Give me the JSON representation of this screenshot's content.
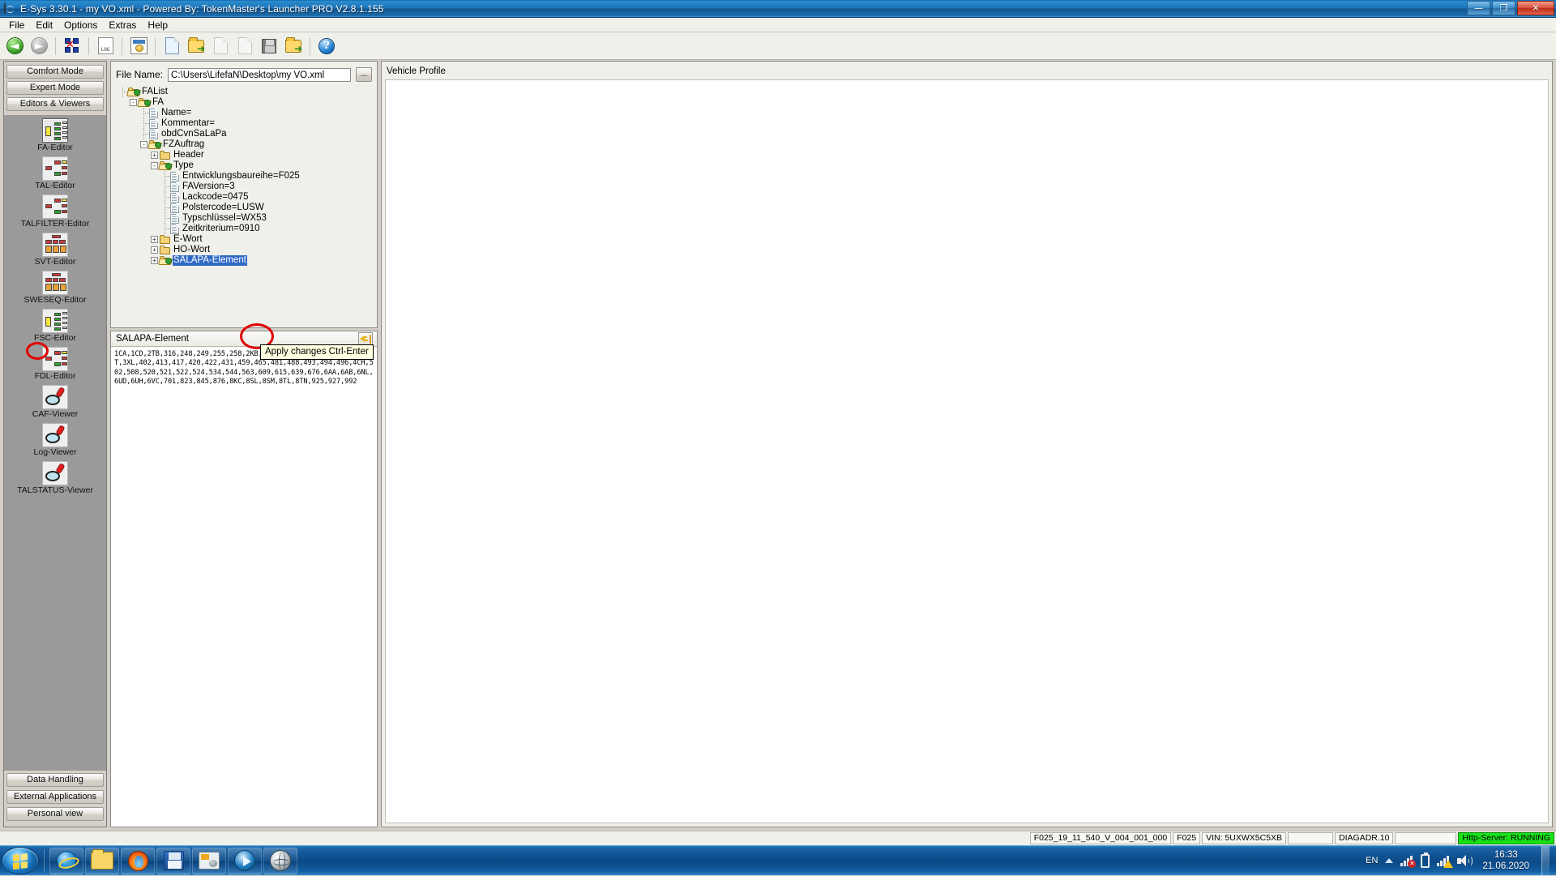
{
  "window": {
    "title": "E-Sys 3.30.1 - my VO.xml   - Powered By: TokenMaster's Launcher PRO V2.8.1.155",
    "minimize": "—",
    "maximize": "❐",
    "close": "✕"
  },
  "menu": {
    "items": [
      "File",
      "Edit",
      "Options",
      "Extras",
      "Help"
    ]
  },
  "toolbar": {
    "items": [
      {
        "name": "back-button",
        "icon": "left-arrow-circle-icon"
      },
      {
        "name": "forward-button",
        "icon": "right-arrow-circle-icon"
      },
      {
        "name": "connection-button",
        "icon": "network-connect-icon"
      },
      {
        "name": "log-button",
        "icon": "log-document-icon"
      },
      {
        "name": "vehicle-window-button",
        "icon": "window-vehicle-icon"
      },
      {
        "name": "new-button",
        "icon": "new-document-icon"
      },
      {
        "name": "open-button",
        "icon": "open-folder-icon"
      },
      {
        "name": "import-button",
        "icon": "import-arrow-icon"
      },
      {
        "name": "export-button",
        "icon": "export-arrow-icon"
      },
      {
        "name": "save-button",
        "icon": "floppy-disk-icon"
      },
      {
        "name": "save-as-button",
        "icon": "folder-save-icon"
      },
      {
        "name": "help-button",
        "icon": "help-question-icon"
      }
    ]
  },
  "sidebar": {
    "modes": [
      "Comfort Mode",
      "Expert Mode",
      "Editors & Viewers"
    ],
    "editors": [
      {
        "label": "FA-Editor",
        "icon": "tree-editor-icon",
        "selected": true
      },
      {
        "label": "TAL-Editor",
        "icon": "tree-editor-icon",
        "selected": false
      },
      {
        "label": "TALFILTER-Editor",
        "icon": "tree-editor-icon",
        "selected": false
      },
      {
        "label": "SVT-Editor",
        "icon": "tree-grid-icon",
        "selected": false
      },
      {
        "label": "SWESEQ-Editor",
        "icon": "tree-grid-icon",
        "selected": false
      },
      {
        "label": "FSC-Editor",
        "icon": "tree-editor-icon",
        "selected": false
      },
      {
        "label": "FDL-Editor",
        "icon": "tree-editor-icon",
        "selected": false
      },
      {
        "label": "CAF-Viewer",
        "icon": "magnifier-icon",
        "selected": false
      },
      {
        "label": "Log-Viewer",
        "icon": "magnifier-icon",
        "selected": false
      },
      {
        "label": "TALSTATUS-Viewer",
        "icon": "magnifier-icon",
        "selected": false
      }
    ],
    "bottom_buttons": [
      "Data Handling",
      "External Applications",
      "Personal view"
    ]
  },
  "fa_editor": {
    "file_label": "File Name:",
    "file_value": "C:\\Users\\LifefaN\\Desktop\\my VO.xml",
    "browse_label": "...",
    "tree": [
      {
        "label": "FAList",
        "depth": 0,
        "type": "folder-green",
        "toggle": "",
        "selected": false
      },
      {
        "label": "FA",
        "depth": 1,
        "type": "folder-green",
        "toggle": "-",
        "selected": false
      },
      {
        "label": "Name=",
        "depth": 2,
        "type": "document",
        "toggle": "",
        "selected": false
      },
      {
        "label": "Kommentar=",
        "depth": 2,
        "type": "document",
        "toggle": "",
        "selected": false
      },
      {
        "label": "obdCvnSaLaPa",
        "depth": 2,
        "type": "document",
        "toggle": "",
        "selected": false
      },
      {
        "label": "FZAuftrag",
        "depth": 2,
        "type": "folder-green",
        "toggle": "-",
        "selected": false
      },
      {
        "label": "Header",
        "depth": 3,
        "type": "folder",
        "toggle": "+",
        "selected": false
      },
      {
        "label": "Type",
        "depth": 3,
        "type": "folder-green",
        "toggle": "-",
        "selected": false
      },
      {
        "label": "Entwicklungsbaureihe=F025",
        "depth": 4,
        "type": "document",
        "toggle": "",
        "selected": false
      },
      {
        "label": "FAVersion=3",
        "depth": 4,
        "type": "document",
        "toggle": "",
        "selected": false
      },
      {
        "label": "Lackcode=0475",
        "depth": 4,
        "type": "document",
        "toggle": "",
        "selected": false
      },
      {
        "label": "Polstercode=LUSW",
        "depth": 4,
        "type": "document",
        "toggle": "",
        "selected": false
      },
      {
        "label": "Typschlüssel=WX53",
        "depth": 4,
        "type": "document",
        "toggle": "",
        "selected": false
      },
      {
        "label": "Zeitkriterium=0910",
        "depth": 4,
        "type": "document",
        "toggle": "",
        "selected": false
      },
      {
        "label": "E-Wort",
        "depth": 3,
        "type": "folder",
        "toggle": "+",
        "selected": false
      },
      {
        "label": "HO-Wort",
        "depth": 3,
        "type": "folder",
        "toggle": "+",
        "selected": false
      },
      {
        "label": "SALAPA-Element",
        "depth": 3,
        "type": "folder-green",
        "toggle": "+",
        "selected": true
      }
    ]
  },
  "salapa": {
    "title": "SALAPA-Element",
    "apply_icon": "apply-arrow-icon",
    "value": "1CA,1CD,2TB,316,248,249,255,258,2KB,2VB,302,316,319,322,3AH,3AT,3XL,402,413,417,420,422,431,459,465,481,488,493,494,496,4CH,502,508,520,521,522,524,534,544,563,609,615,639,676,6AA,6AB,6NL,6UD,6UH,6VC,701,823,845,876,8KC,8SL,8SM,8TL,8TN,925,927,992"
  },
  "vehicle_profile": {
    "title": "Vehicle Profile"
  },
  "tooltip": {
    "text": "Apply changes  Ctrl-Enter"
  },
  "statusbar": {
    "cells": [
      {
        "text": "F025_19_11_540_V_004_001_000",
        "style": "normal"
      },
      {
        "text": "F025",
        "style": "normal"
      },
      {
        "text": "VIN: 5UXWX5C5XB",
        "style": "normal"
      },
      {
        "text": "",
        "style": "blank"
      },
      {
        "text": "DIAGADR.10",
        "style": "normal"
      },
      {
        "text": "",
        "style": "blank2"
      },
      {
        "text": "Http-Server: RUNNING",
        "style": "green"
      }
    ]
  },
  "taskbar": {
    "start": "start-orb",
    "apps": [
      {
        "name": "internet-explorer-icon"
      },
      {
        "name": "file-explorer-icon"
      },
      {
        "name": "firefox-icon"
      },
      {
        "name": "floppy-save-icon"
      },
      {
        "name": "esys-app-icon"
      },
      {
        "name": "media-player-icon"
      },
      {
        "name": "globe-browser-icon"
      }
    ],
    "tray": {
      "language": "EN",
      "icons": [
        "show-hidden-icons",
        "network-disconnected-icon",
        "battery-icon",
        "signal-warning-icon",
        "volume-icon"
      ],
      "time": "16:33",
      "date": "21.06.2020"
    }
  },
  "colors": {
    "accent": "#316ac5",
    "annotation": "#e00000",
    "status_running": "#19e219",
    "sidebar_bg": "#9a9a9a"
  }
}
